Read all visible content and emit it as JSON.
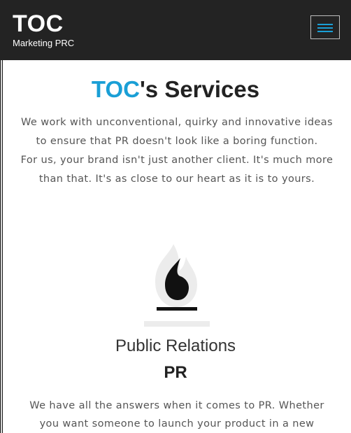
{
  "navbar": {
    "brand_title": "TOC",
    "brand_subtitle": "Marketing PRC",
    "menu_icon": "hamburger-menu-icon"
  },
  "services": {
    "title_accent": "TOC",
    "title_rest": "'s Services",
    "intro_line1": "We work with unconventional, quirky and innovative ideas to ensure that PR doesn't look like a boring function.",
    "intro_line2": "For us, your brand isn't just another client. It's much more than that. It's as close to our heart as it is to yours."
  },
  "service_item": {
    "icon": "flame-icon",
    "name": "Public Relations",
    "abbr": "PR",
    "description": "We have all the answers when it comes to PR. Whether you want someone to launch your product in a new"
  },
  "colors": {
    "navbar_bg": "#232323",
    "accent": "#1a9fd6",
    "text": "#555555"
  }
}
